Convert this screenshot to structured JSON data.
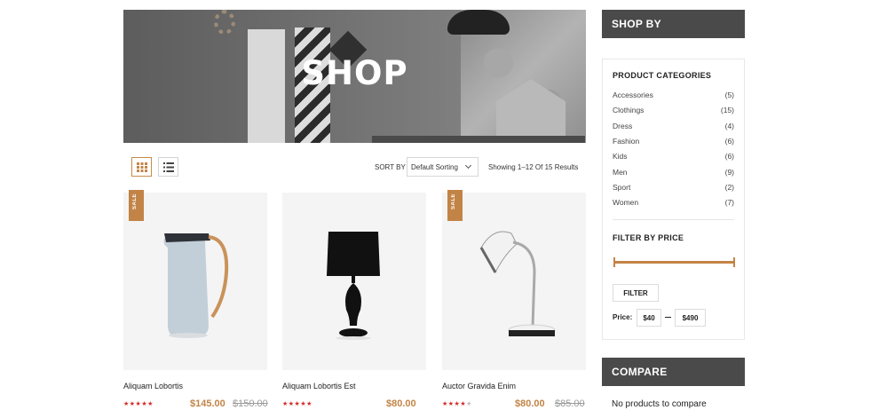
{
  "banner": {
    "title": "SHOP"
  },
  "toolbar": {
    "grid_icon": "grid-view-icon",
    "list_icon": "list-view-icon",
    "sort_label": "SORT BY",
    "sort_value": "Default Sorting",
    "result_count": "Showing 1–12 Of 15 Results"
  },
  "products": [
    {
      "name": "Aliquam Lobortis",
      "price": "$145.00",
      "old_price": "$150.00",
      "sale": "SALE",
      "rating": 5
    },
    {
      "name": "Aliquam Lobortis Est",
      "price": "$80.00",
      "old_price": "",
      "sale": "",
      "rating": 5
    },
    {
      "name": "Auctor Gravida Enim",
      "price": "$80.00",
      "old_price": "$85.00",
      "sale": "SALE",
      "rating": 4
    }
  ],
  "sidebar": {
    "shop_by": "SHOP BY",
    "categories_title": "PRODUCT CATEGORIES",
    "categories": [
      {
        "label": "Accessories",
        "count": "(5)"
      },
      {
        "label": "Clothings",
        "count": "(15)"
      },
      {
        "label": "Dress",
        "count": "(4)"
      },
      {
        "label": "Fashion",
        "count": "(6)"
      },
      {
        "label": "Kids",
        "count": "(6)"
      },
      {
        "label": "Men",
        "count": "(9)"
      },
      {
        "label": "Sport",
        "count": "(2)"
      },
      {
        "label": "Women",
        "count": "(7)"
      }
    ],
    "price_title": "FILTER BY PRICE",
    "filter_label": "FILTER",
    "price_label": "Price:",
    "price_min": "$40",
    "price_max": "$490",
    "compare_title": "COMPARE",
    "compare_text": "No products to compare"
  },
  "colors": {
    "accent": "#c28446",
    "star": "#d62828",
    "header_bg": "#4a4a4a"
  }
}
